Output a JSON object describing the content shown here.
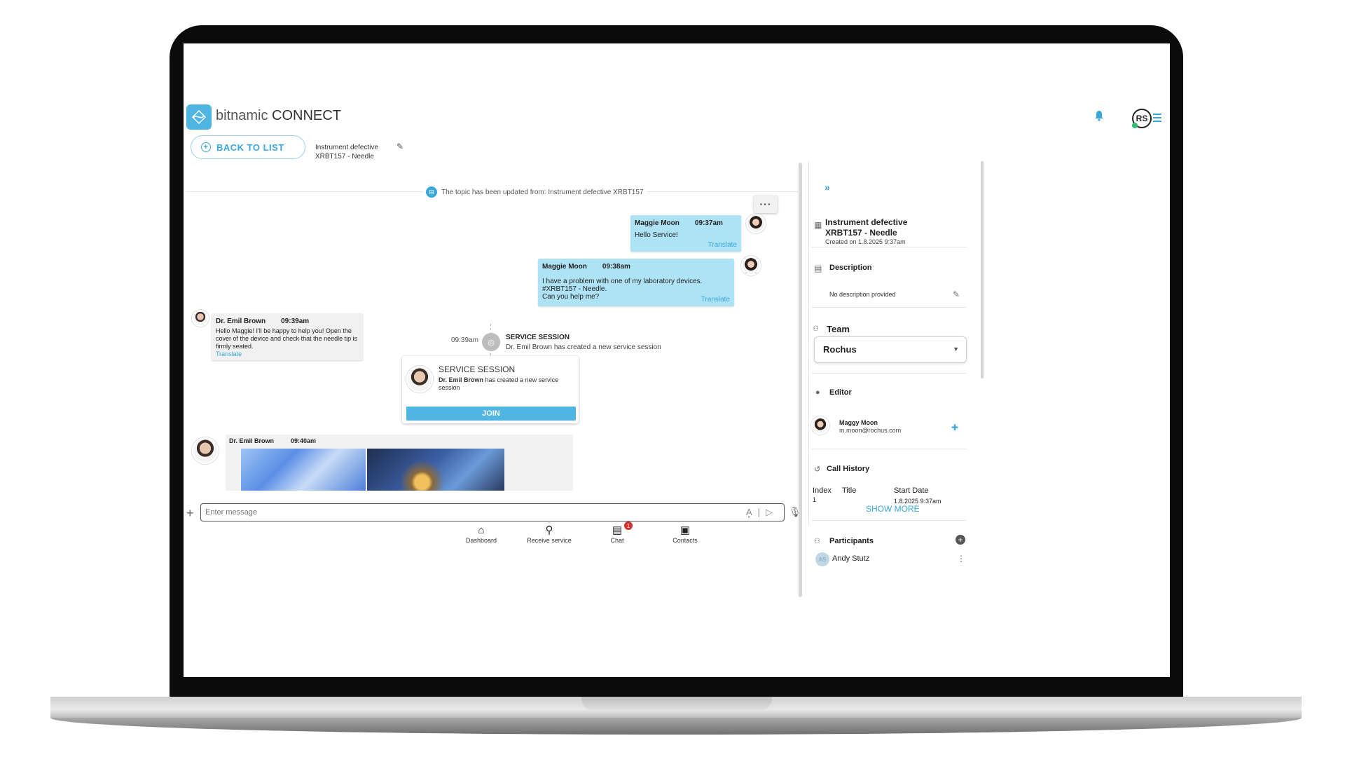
{
  "app": {
    "brand_prefix": "bitnamic",
    "brand_suffix": "CONNECT"
  },
  "header": {
    "avatar_initials": "RS"
  },
  "toolbar": {
    "back_label": "BACK TO LIST",
    "topic_line1": "Instrument defective",
    "topic_line2": "XRBT157 - Needle"
  },
  "system_message": "The topic has been updated from: Instrument defective XRBT157",
  "messages": [
    {
      "author": "Maggie Moon",
      "time": "09:37am",
      "text": "Hello Service!",
      "translate": "Translate"
    },
    {
      "author": "Maggie Moon",
      "time": "09:38am",
      "line1": "I have a problem with one of my laboratory devices.",
      "line2": "#XRBT157 - Needle.",
      "line3": "Can you help me?",
      "translate": "Translate"
    },
    {
      "author": "Dr. Emil Brown",
      "time": "09:39am",
      "text": "Hello Maggie! I'll be happy to help you! Open the cover of the device and check that the needle tip is firmly seated.",
      "translate": "Translate"
    },
    {
      "author": "Dr. Emil Brown",
      "time": "09:40am"
    }
  ],
  "session_event": {
    "time": "09:39am",
    "title": "SERVICE SESSION",
    "subtitle": "Dr. Emil Brown has created a new service session"
  },
  "session_card": {
    "title": "SERVICE SESSION",
    "author": "Dr. Emil Brown",
    "desc": "has created a new service session",
    "join_label": "JOIN"
  },
  "composer": {
    "placeholder": "Enter message"
  },
  "bottom_nav": [
    {
      "label": "Dashboard"
    },
    {
      "label": "Receive service"
    },
    {
      "label": "Chat",
      "badge": "1"
    },
    {
      "label": "Contacts"
    }
  ],
  "sidebar": {
    "title_line1": "Instrument defective",
    "title_line2": "XRBT157 - Needle",
    "created": "Created on 1.8.2025 9:37am",
    "description_heading": "Description",
    "description_value": "No description provided",
    "team_heading": "Team",
    "team_value": "Rochus",
    "editor_heading": "Editor",
    "editor_name": "Maggy Moon",
    "editor_email": "m.moon@rochus.com",
    "call_history_heading": "Call History",
    "call_history_columns": [
      "Index",
      "Title",
      "Start Date"
    ],
    "call_history_row": {
      "index": "1",
      "title": "",
      "start_date": "1.8.2025 9:37am"
    },
    "show_more": "SHOW MORE",
    "participants_heading": "Participants",
    "participant_initials": "AS",
    "participant_name": "Andy Stutz"
  }
}
